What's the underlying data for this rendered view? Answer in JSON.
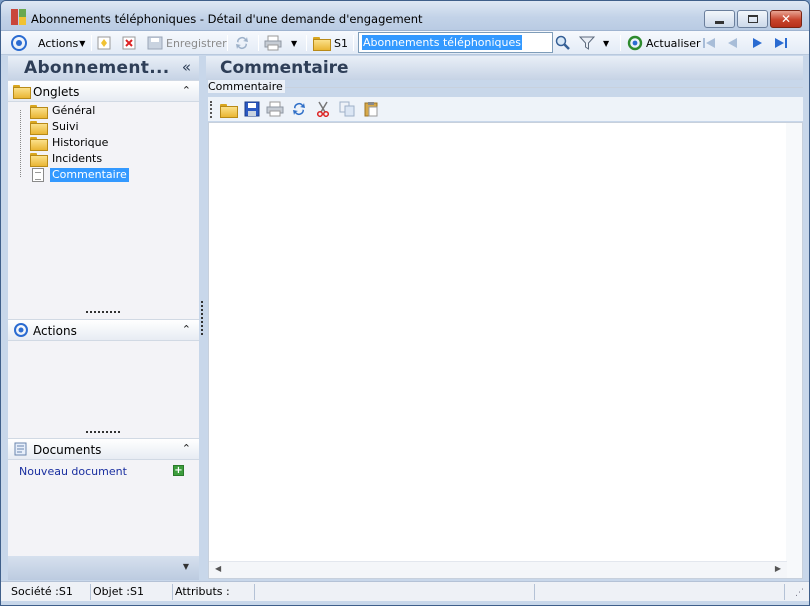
{
  "window": {
    "title": "Abonnements téléphoniques -  Détail d'une demande d'engagement"
  },
  "toolbar": {
    "actions_label": "Actions",
    "save_label": "Enregistrer",
    "s1_label": "S1",
    "search_value": "Abonnements téléphoniques",
    "refresh_label": "Actualiser"
  },
  "left_panel": {
    "title": "Abonnement...",
    "tabs_header": "Onglets",
    "tree": [
      {
        "label": "Général"
      },
      {
        "label": "Suivi"
      },
      {
        "label": "Historique"
      },
      {
        "label": "Incidents"
      },
      {
        "label": "Commentaire"
      }
    ],
    "actions_header": "Actions",
    "documents_header": "Documents",
    "new_document_link": "Nouveau document"
  },
  "main": {
    "title": "Commentaire",
    "group_label": "Commentaire"
  },
  "statusbar": {
    "societe": "Société :S1",
    "objet": "Objet :S1",
    "attributs": "Attributs :"
  },
  "colors": {
    "accent": "#3399ff",
    "frame": "#c8d7ea",
    "header_text": "#2e3e57"
  }
}
